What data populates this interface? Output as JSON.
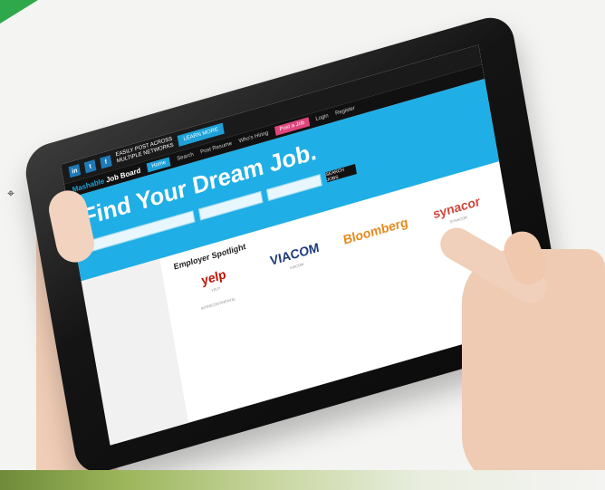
{
  "topbar": {
    "post_line1": "EASILY POST ACROSS",
    "post_line2": "MULTIPLE NETWORKS",
    "social": [
      "in",
      "t",
      "f"
    ],
    "learn_more": "LEARN MORE"
  },
  "navbar": {
    "brand_accent": "Mashable",
    "brand_rest": "Job Board",
    "items": [
      "Home",
      "Search",
      "Post Resume",
      "Who's Hiring",
      "Post a Job",
      "Login",
      "Register"
    ],
    "active_index": 0,
    "highlight_index": 4
  },
  "hero": {
    "title": "Find Your Dream Job.",
    "search_button": "SEARCH JOBS"
  },
  "spotlight": {
    "title": "Employer Spotlight",
    "logos": [
      {
        "name": "yelp",
        "color": "#c41200"
      },
      {
        "name": "VIACOM",
        "color": "#1b3a7a"
      },
      {
        "name": "Bloomberg",
        "color": "#e7891b"
      },
      {
        "name": "synacor",
        "color": "#d0453a"
      }
    ],
    "labels": [
      "YELP",
      "VIACOM",
      "SYNACOR",
      "INTERCONTINENTAL"
    ]
  },
  "colors": {
    "accent": "#1faee6",
    "nav_bg": "#111111",
    "highlight": "#e0457b",
    "corner": "#2ea84a"
  }
}
